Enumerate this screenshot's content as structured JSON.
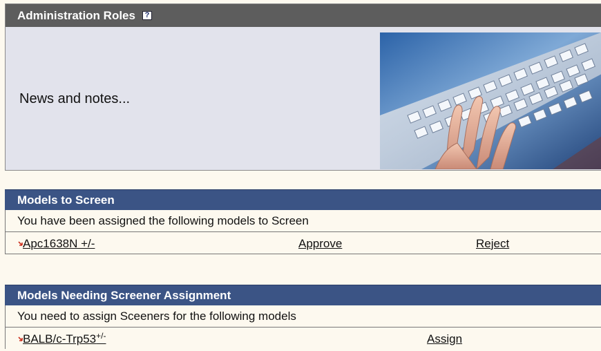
{
  "admin": {
    "title": "Administration Roles",
    "help_icon": "?",
    "news": "News and notes..."
  },
  "screen": {
    "title": "Models to Screen",
    "description": "You have been assigned the following models to Screen",
    "rows": [
      {
        "model": "Apc1638N +/-",
        "approve": "Approve",
        "reject": "Reject"
      }
    ]
  },
  "assign": {
    "title": "Models Needing Screener Assignment",
    "description": "You need to assign Sceeners for the following models",
    "rows": [
      {
        "model": "BALB/c-Trp53",
        "genotype": "+/-",
        "assign": "Assign"
      }
    ]
  },
  "colors": {
    "admin_header": "#5d5d5d",
    "section_header": "#3b5485",
    "page_bg": "#fdf9ef",
    "panel_bg": "#e2e3ec",
    "arrow": "#cc3322"
  }
}
